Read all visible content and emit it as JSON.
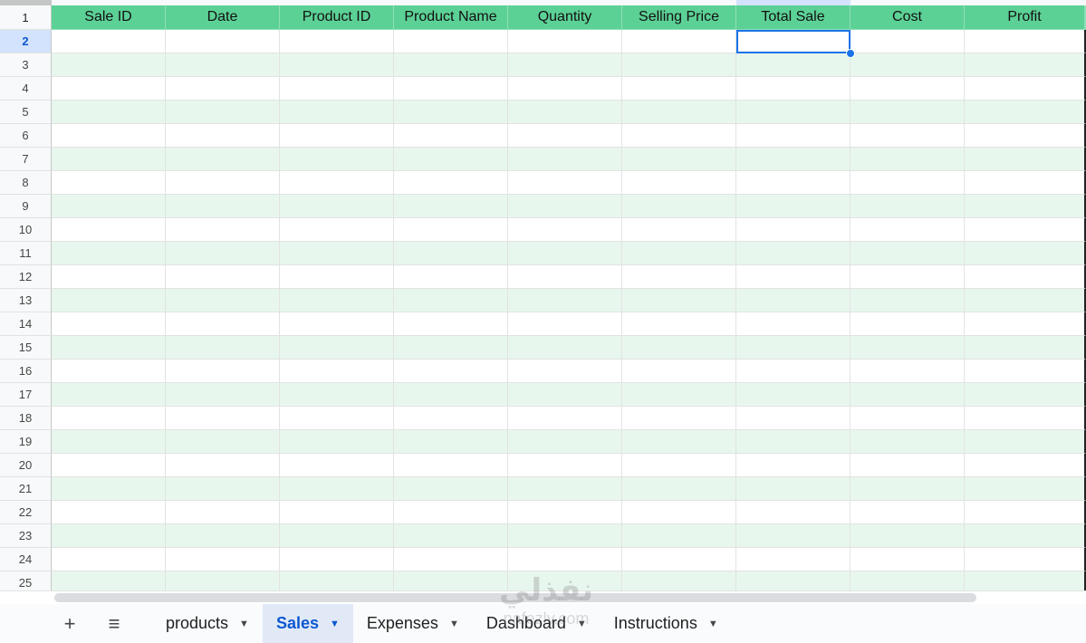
{
  "sheet": {
    "columns": [
      "Sale ID",
      "Date",
      "Product ID",
      "Product Name",
      "Quantity",
      "Selling Price",
      "Total Sale",
      "Cost",
      "Profit"
    ],
    "row_numbers": [
      "1",
      "2",
      "3",
      "4",
      "5",
      "6",
      "7",
      "8",
      "9",
      "10",
      "11",
      "12",
      "13",
      "14",
      "15",
      "16",
      "17",
      "18",
      "19",
      "20",
      "21",
      "22",
      "23",
      "24",
      "25"
    ],
    "active_row": "2",
    "active_column": "Total Sale",
    "colors": {
      "header_bg": "#5cd196",
      "alt_row_bg": "#e8f7ee",
      "selection": "#1a73e8"
    }
  },
  "tabbar": {
    "add_icon": "+",
    "menu_icon": "≡",
    "tabs": [
      {
        "label": "products",
        "active": false
      },
      {
        "label": "Sales",
        "active": true
      },
      {
        "label": "Expenses",
        "active": false
      },
      {
        "label": "Dashboard",
        "active": false
      },
      {
        "label": "Instructions",
        "active": false
      }
    ]
  },
  "watermark": {
    "text": "nafezly.com"
  }
}
